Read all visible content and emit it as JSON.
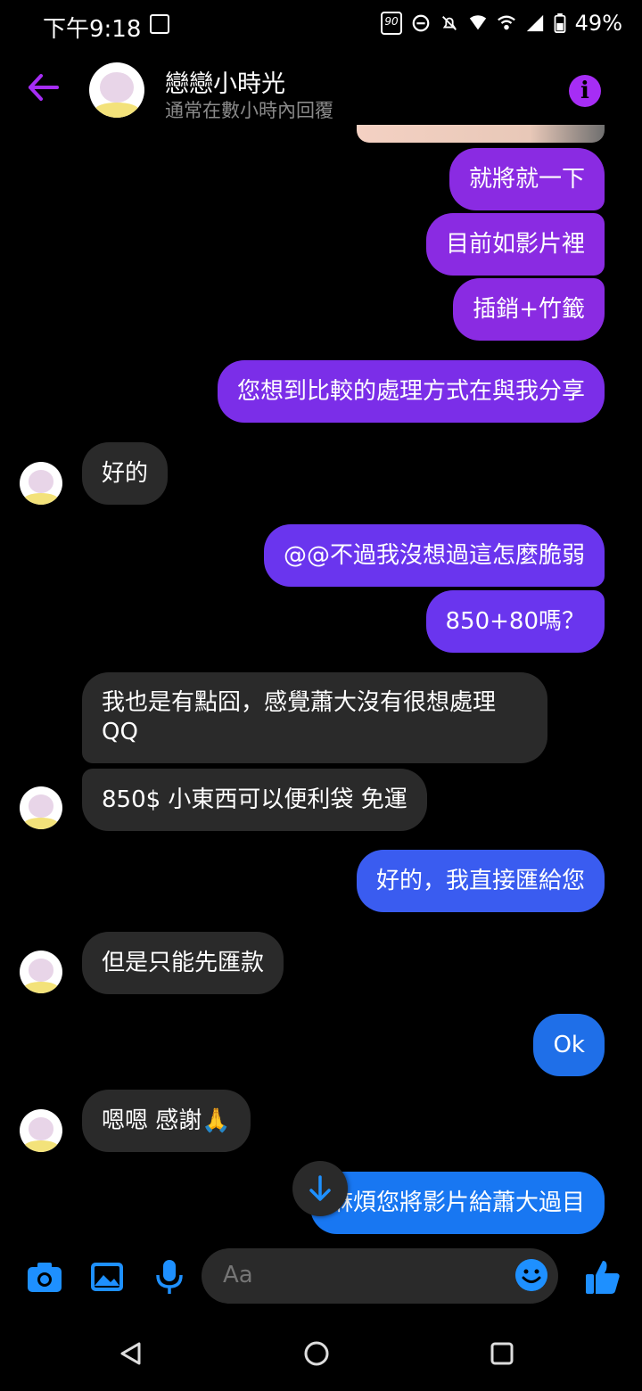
{
  "status_bar": {
    "time": "下午9:18",
    "battery": "49%",
    "refresh_badge": "90"
  },
  "header": {
    "contact_name": "戀戀小時光",
    "contact_status": "通常在數小時內回覆",
    "accent_color": "#a62df5"
  },
  "messages": [
    {
      "dir": "out",
      "text": "就將就一下",
      "color": "#8a2be2"
    },
    {
      "dir": "out",
      "text": "目前如影片裡",
      "color": "#8a2be2"
    },
    {
      "dir": "out",
      "text": "插銷+竹籤",
      "color": "#8a2be2"
    },
    {
      "dir": "out",
      "text": "您想到比較的處理方式在與我分享",
      "color": "#7b2ee8"
    },
    {
      "dir": "in",
      "text": "好的"
    },
    {
      "dir": "out",
      "text": "@@不過我沒想過這怎麼脆弱",
      "color": "#6a35ee"
    },
    {
      "dir": "out",
      "text": "850+80嗎？",
      "color": "#6a35ee"
    },
    {
      "dir": "in",
      "text": "我也是有點囧，感覺蕭大沒有很想處理\nQQ"
    },
    {
      "dir": "in",
      "text": "850$ 小東西可以便利袋 免運"
    },
    {
      "dir": "out",
      "text": "好的，我直接匯給您",
      "color": "#3a5cf0"
    },
    {
      "dir": "in",
      "text": "但是只能先匯款"
    },
    {
      "dir": "out",
      "text": "Ok",
      "color": "#1f6fe8"
    },
    {
      "dir": "in",
      "text": "嗯嗯 感謝🙏"
    },
    {
      "dir": "out",
      "text": "麻煩您將影片給蕭大過目",
      "color": "#1877f2"
    }
  ],
  "composer": {
    "placeholder": "Aa"
  },
  "icons": {
    "back": "arrow-left-icon",
    "info": "info-icon",
    "camera": "camera-icon",
    "gallery": "image-icon",
    "mic": "microphone-icon",
    "emoji": "smiley-icon",
    "like": "thumbs-up-icon",
    "scroll": "arrow-down-icon"
  },
  "colors": {
    "toolbar_blue": "#1e90ff",
    "incoming_bubble": "#2a2a2a"
  }
}
